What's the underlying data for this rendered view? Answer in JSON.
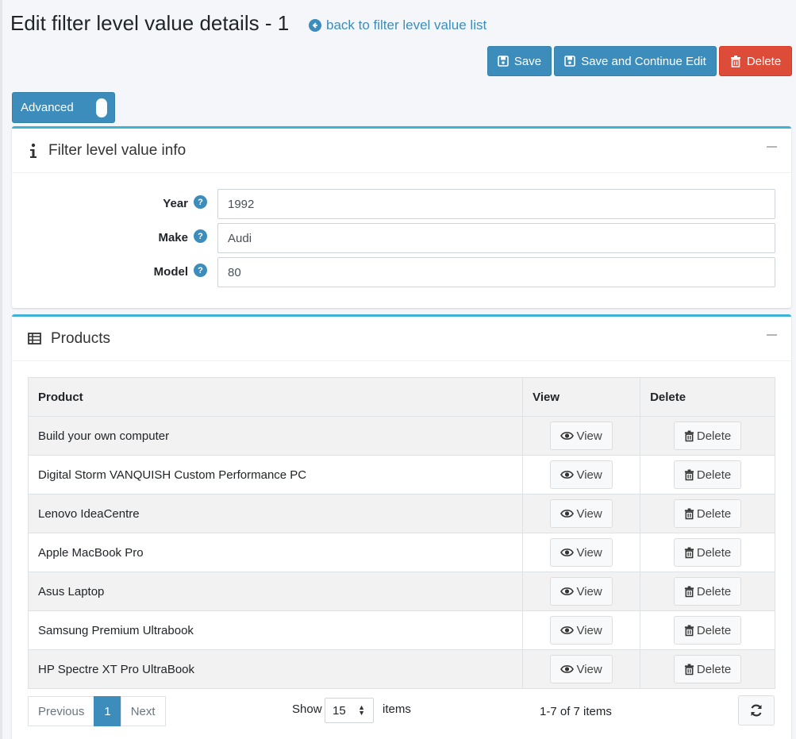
{
  "header": {
    "title": "Edit filter level value details - 1",
    "back_link": "back to filter level value list"
  },
  "toolbar": {
    "save_label": "Save",
    "save_continue_label": "Save and Continue Edit",
    "delete_label": "Delete",
    "advanced_label": "Advanced"
  },
  "info_card": {
    "title": "Filter level value info",
    "fields": [
      {
        "label": "Year",
        "value": "1992"
      },
      {
        "label": "Make",
        "value": "Audi"
      },
      {
        "label": "Model",
        "value": "80"
      }
    ]
  },
  "products_card": {
    "title": "Products",
    "columns": [
      "Product",
      "View",
      "Delete"
    ],
    "view_label": "View",
    "delete_label": "Delete",
    "rows": [
      "Build your own computer",
      "Digital Storm VANQUISH Custom Performance PC",
      "Lenovo IdeaCentre",
      "Apple MacBook Pro",
      "Asus Laptop",
      "Samsung Premium Ultrabook",
      "HP Spectre XT Pro UltraBook"
    ],
    "pager": {
      "previous": "Previous",
      "current": "1",
      "next": "Next",
      "show_label": "Show",
      "page_size": "15",
      "items_label": "items",
      "count_text": "1-7 of 7 items"
    }
  },
  "colors": {
    "primary": "#3c8dbc",
    "danger": "#dd4b39",
    "card_accent": "#3fb2d6"
  }
}
